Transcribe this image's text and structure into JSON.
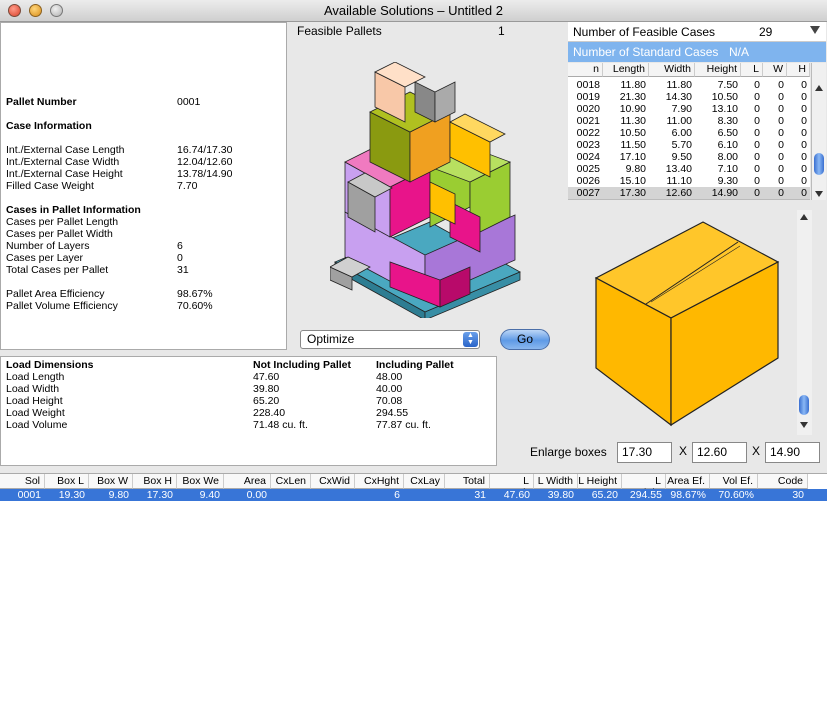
{
  "window": {
    "title": "Available Solutions – Untitled 2"
  },
  "info": {
    "pallet_number_label": "Pallet Number",
    "pallet_number": "0001",
    "case_info_head": "Case Information",
    "case_length_label": "Int./External Case Length",
    "case_length": "16.74/17.30",
    "case_width_label": "Int./External Case Width",
    "case_width": "12.04/12.60",
    "case_height_label": "Int./External Case Height",
    "case_height": "13.78/14.90",
    "case_weight_label": "Filled Case Weight",
    "case_weight": "7.70",
    "cases_in_pallet_head": "Cases in Pallet Information",
    "cpl_label": "Cases per Pallet Length",
    "cpl": "",
    "cpw_label": "Cases per Pallet Width",
    "cpw": "",
    "layers_label": "Number of Layers",
    "layers": "6",
    "cpl2_label": "Cases per Layer",
    "cpl2": "0",
    "total_label": "Total Cases per Pallet",
    "total": "31",
    "area_eff_label": "Pallet Area Efficiency",
    "area_eff": "98.67%",
    "vol_eff_label": "Pallet Volume Efficiency",
    "vol_eff": "70.60%"
  },
  "pallets": {
    "label": "Feasible Pallets",
    "count": "1"
  },
  "controls": {
    "mode": "Optimize",
    "go": "Go",
    "enlarge_label": "Enlarge boxes",
    "enlarge_l": "17.30",
    "enlarge_w": "12.60",
    "enlarge_h": "14.90",
    "x_sep": "X"
  },
  "cases": {
    "feasible_label": "Number of Feasible Cases",
    "feasible_count": "29",
    "standard_label": "Number of Standard Cases",
    "standard_count": "N/A",
    "columns": [
      "n",
      "Length",
      "Width",
      "Height",
      "L",
      "W",
      "H"
    ],
    "rows": [
      [
        "0018",
        "11.80",
        "11.80",
        "7.50",
        "0",
        "0",
        "0"
      ],
      [
        "0019",
        "21.30",
        "14.30",
        "10.50",
        "0",
        "0",
        "0"
      ],
      [
        "0020",
        "10.90",
        "7.90",
        "13.10",
        "0",
        "0",
        "0"
      ],
      [
        "0021",
        "11.30",
        "11.00",
        "8.30",
        "0",
        "0",
        "0"
      ],
      [
        "0022",
        "10.50",
        "6.00",
        "6.50",
        "0",
        "0",
        "0"
      ],
      [
        "0023",
        "11.50",
        "5.70",
        "6.10",
        "0",
        "0",
        "0"
      ],
      [
        "0024",
        "17.10",
        "9.50",
        "8.00",
        "0",
        "0",
        "0"
      ],
      [
        "0025",
        "9.80",
        "13.40",
        "7.10",
        "0",
        "0",
        "0"
      ],
      [
        "0026",
        "15.10",
        "11.10",
        "9.30",
        "0",
        "0",
        "0"
      ],
      [
        "0027",
        "17.30",
        "12.60",
        "14.90",
        "0",
        "0",
        "0"
      ]
    ]
  },
  "load": {
    "head": [
      "Load Dimensions",
      "Not Including Pallet",
      "Including Pallet"
    ],
    "rows": [
      [
        "Load Length",
        "47.60",
        "48.00"
      ],
      [
        "Load Width",
        "39.80",
        "40.00"
      ],
      [
        "Load Height",
        "65.20",
        "70.08"
      ],
      [
        "Load Weight",
        "228.40",
        "294.55"
      ],
      [
        "Load Volume",
        "71.48 cu. ft.",
        "77.87 cu. ft."
      ]
    ]
  },
  "solutions": {
    "columns": [
      "Sol",
      "Box L",
      "Box W",
      "Box H",
      "Box We",
      "Area",
      "CxLen",
      "CxWid",
      "CxHght",
      "CxLay",
      "Total",
      "L Length",
      "L Width",
      "L Height",
      "L Weight",
      "Area Ef.",
      "Vol Ef.",
      "Code"
    ],
    "rows": [
      [
        "0001",
        "19.30",
        "9.80",
        "17.30",
        "9.40",
        "0.00",
        "",
        "",
        "6",
        "",
        "31",
        "47.60",
        "39.80",
        "65.20",
        "294.55",
        "98.67%",
        "70.60%",
        "30"
      ]
    ]
  },
  "colors": {
    "selection": "#3875d7",
    "box": "#ffb800",
    "standard_header": "#7fb4ee"
  }
}
